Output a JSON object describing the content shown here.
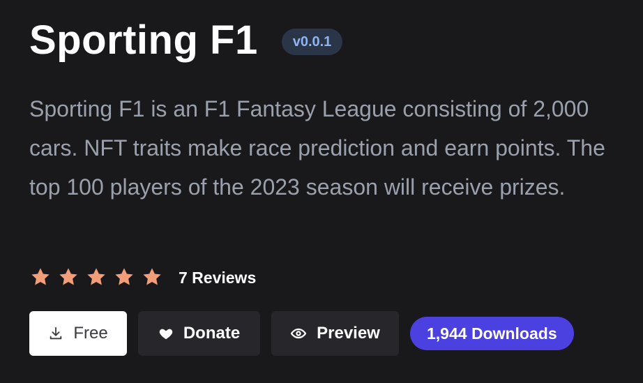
{
  "app": {
    "title": "Sporting F1",
    "version": "v0.0.1",
    "description": "Sporting F1 is an F1 Fantasy League consisting of 2,000 cars. NFT traits make race prediction and earn points. The top 100 players of the 2023 season will receive prizes."
  },
  "rating": {
    "stars": 5,
    "star_color": "#f29e7a",
    "reviews_label": "7 Reviews"
  },
  "actions": {
    "free_label": "Free",
    "free_icon": "download-icon",
    "donate_label": "Donate",
    "donate_icon": "heart-icon",
    "preview_label": "Preview",
    "preview_icon": "eye-icon",
    "downloads_label": "1,944 Downloads",
    "downloads_color": "#4b40e0"
  }
}
